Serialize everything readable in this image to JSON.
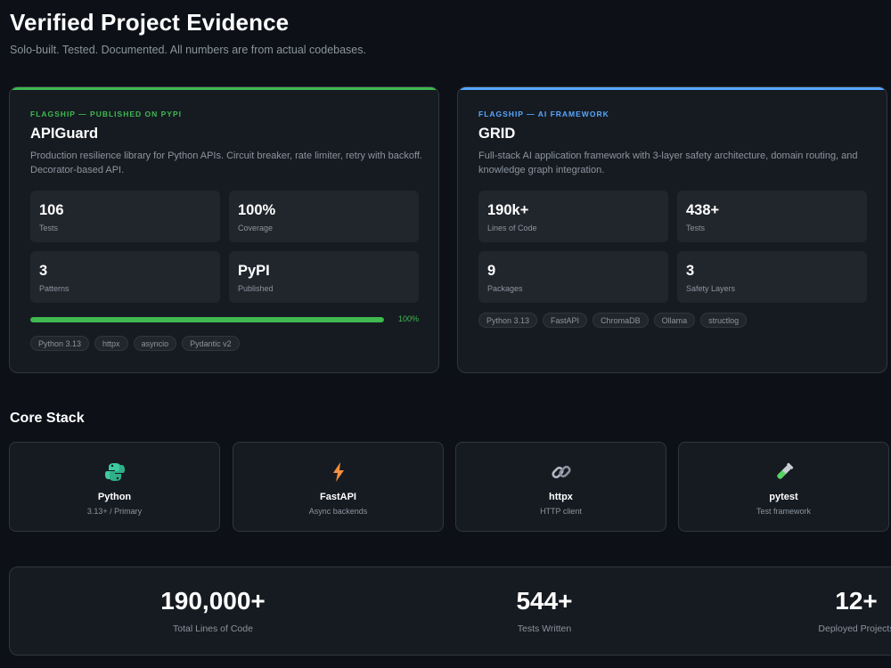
{
  "header": {
    "title": "Verified Project Evidence",
    "subtitle": "Solo-built. Tested. Documented. All numbers are from actual codebases."
  },
  "projects": [
    {
      "eyebrow": "FLAGSHIP — PUBLISHED ON PYPI",
      "name": "APIGuard",
      "description": "Production resilience library for Python APIs. Circuit breaker, rate limiter, retry with backoff. Decorator-based API.",
      "accent_color": "#3fb950",
      "stats": [
        {
          "value": "106",
          "label": "Tests"
        },
        {
          "value": "100%",
          "label": "Coverage"
        },
        {
          "value": "3",
          "label": "Patterns"
        },
        {
          "value": "PyPI",
          "label": "Published"
        }
      ],
      "progress": {
        "percent": 100,
        "label": "100%"
      },
      "tags": [
        "Python 3.13",
        "httpx",
        "asyncio",
        "Pydantic v2"
      ]
    },
    {
      "eyebrow": "FLAGSHIP — AI FRAMEWORK",
      "name": "GRID",
      "description": "Full-stack AI application framework with 3-layer safety architecture, domain routing, and knowledge graph integration.",
      "accent_color": "#58a6ff",
      "stats": [
        {
          "value": "190k+",
          "label": "Lines of Code"
        },
        {
          "value": "438+",
          "label": "Tests"
        },
        {
          "value": "9",
          "label": "Packages"
        },
        {
          "value": "3",
          "label": "Safety Layers"
        }
      ],
      "tags": [
        "Python 3.13",
        "FastAPI",
        "ChromaDB",
        "Ollama",
        "structlog"
      ]
    }
  ],
  "core_stack": {
    "title": "Core Stack",
    "items": [
      {
        "name": "Python",
        "description": "3.13+ / Primary",
        "icon": "python-icon"
      },
      {
        "name": "FastAPI",
        "description": "Async backends",
        "icon": "lightning-icon"
      },
      {
        "name": "httpx",
        "description": "HTTP client",
        "icon": "link-icon"
      },
      {
        "name": "pytest",
        "description": "Test framework",
        "icon": "test-tube-icon"
      }
    ]
  },
  "totals": [
    {
      "value": "190,000+",
      "label": "Total Lines of Code"
    },
    {
      "value": "544+",
      "label": "Tests Written"
    },
    {
      "value": "12+",
      "label": "Deployed Projects"
    }
  ]
}
